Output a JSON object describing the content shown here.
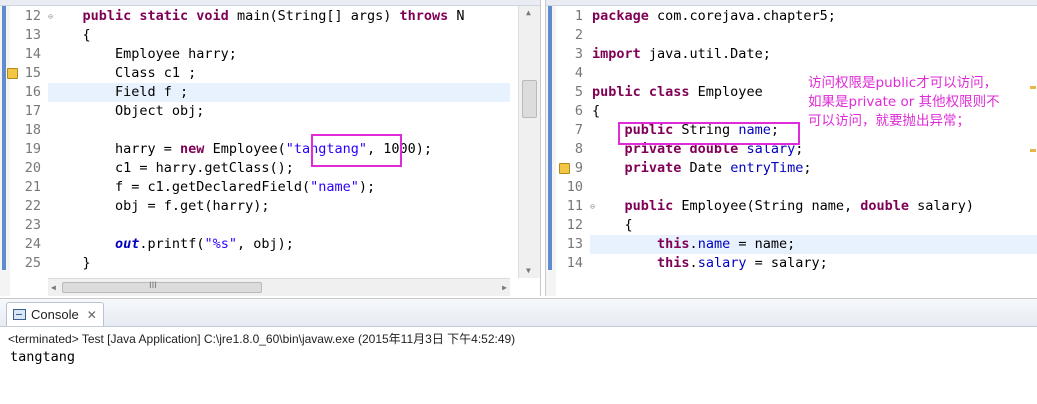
{
  "left_editor": {
    "lines": [
      {
        "n": "12",
        "hl": false,
        "warn": false,
        "fold": true,
        "tokens": [
          [
            "",
            "    "
          ],
          [
            "kw",
            "public static void "
          ],
          [
            "",
            "main(String[] args) "
          ],
          [
            "kw",
            "throws"
          ],
          [
            "",
            " N"
          ]
        ]
      },
      {
        "n": "13",
        "hl": false,
        "warn": false,
        "fold": false,
        "tokens": [
          [
            "",
            "    {"
          ]
        ]
      },
      {
        "n": "14",
        "hl": false,
        "warn": false,
        "fold": false,
        "tokens": [
          [
            "",
            "        Employee harry;"
          ]
        ]
      },
      {
        "n": "15",
        "hl": false,
        "warn": true,
        "fold": false,
        "tokens": [
          [
            "",
            "        Class c1 ;"
          ]
        ]
      },
      {
        "n": "16",
        "hl": true,
        "warn": false,
        "fold": false,
        "tokens": [
          [
            "",
            "        Field f ;"
          ]
        ]
      },
      {
        "n": "17",
        "hl": false,
        "warn": false,
        "fold": false,
        "tokens": [
          [
            "",
            "        Object obj;"
          ]
        ]
      },
      {
        "n": "18",
        "hl": false,
        "warn": false,
        "fold": false,
        "tokens": [
          [
            "",
            ""
          ]
        ]
      },
      {
        "n": "19",
        "hl": false,
        "warn": false,
        "fold": false,
        "tokens": [
          [
            "",
            "        harry = "
          ],
          [
            "kw",
            "new "
          ],
          [
            "",
            "Employee("
          ],
          [
            "str",
            "\"tangtang\""
          ],
          [
            "",
            ", 1000);"
          ]
        ]
      },
      {
        "n": "20",
        "hl": false,
        "warn": false,
        "fold": false,
        "tokens": [
          [
            "",
            "        c1 = harry.getClass();"
          ]
        ]
      },
      {
        "n": "21",
        "hl": false,
        "warn": false,
        "fold": false,
        "tokens": [
          [
            "",
            "        f = c1.getDeclaredField("
          ],
          [
            "str",
            "\"name\""
          ],
          [
            "",
            ");"
          ]
        ]
      },
      {
        "n": "22",
        "hl": false,
        "warn": false,
        "fold": false,
        "tokens": [
          [
            "",
            "        obj = f.get(harry);"
          ]
        ]
      },
      {
        "n": "23",
        "hl": false,
        "warn": false,
        "fold": false,
        "tokens": [
          [
            "",
            ""
          ]
        ]
      },
      {
        "n": "24",
        "hl": false,
        "warn": false,
        "fold": false,
        "tokens": [
          [
            "",
            "        "
          ],
          [
            "sfld",
            "out"
          ],
          [
            "",
            ".printf("
          ],
          [
            "str",
            "\"%s\""
          ],
          [
            "",
            ", obj);"
          ]
        ]
      },
      {
        "n": "25",
        "hl": false,
        "warn": false,
        "fold": false,
        "tokens": [
          [
            "",
            "    }"
          ]
        ]
      }
    ],
    "hscroll_thumb_label": "III"
  },
  "right_editor": {
    "lines": [
      {
        "n": "1",
        "hl": false,
        "warn": false,
        "fold": false,
        "tokens": [
          [
            "kw",
            "package "
          ],
          [
            "",
            "com.corejava.chapter5;"
          ]
        ]
      },
      {
        "n": "2",
        "hl": false,
        "warn": false,
        "fold": false,
        "tokens": [
          [
            "",
            ""
          ]
        ]
      },
      {
        "n": "3",
        "hl": false,
        "warn": false,
        "fold": false,
        "tokens": [
          [
            "kw",
            "import "
          ],
          [
            "",
            "java.util.Date;"
          ]
        ]
      },
      {
        "n": "4",
        "hl": false,
        "warn": false,
        "fold": false,
        "tokens": [
          [
            "",
            ""
          ]
        ]
      },
      {
        "n": "5",
        "hl": false,
        "warn": false,
        "fold": false,
        "tokens": [
          [
            "kw",
            "public class "
          ],
          [
            "",
            "Employee"
          ]
        ]
      },
      {
        "n": "6",
        "hl": false,
        "warn": false,
        "fold": false,
        "tokens": [
          [
            "",
            "{"
          ]
        ]
      },
      {
        "n": "7",
        "hl": false,
        "warn": false,
        "fold": false,
        "tokens": [
          [
            "",
            "    "
          ],
          [
            "kw",
            "public "
          ],
          [
            "",
            "String "
          ],
          [
            "fld",
            "name"
          ],
          [
            "",
            ";"
          ]
        ]
      },
      {
        "n": "8",
        "hl": false,
        "warn": false,
        "fold": false,
        "tokens": [
          [
            "",
            "    "
          ],
          [
            "kw",
            "private double "
          ],
          [
            "fld",
            "salary"
          ],
          [
            "",
            ";"
          ]
        ]
      },
      {
        "n": "9",
        "hl": false,
        "warn": true,
        "fold": false,
        "tokens": [
          [
            "",
            "    "
          ],
          [
            "kw",
            "private "
          ],
          [
            "",
            "Date "
          ],
          [
            "fld",
            "entryTime"
          ],
          [
            "",
            ";"
          ]
        ]
      },
      {
        "n": "10",
        "hl": false,
        "warn": false,
        "fold": false,
        "tokens": [
          [
            "",
            ""
          ]
        ]
      },
      {
        "n": "11",
        "hl": false,
        "warn": false,
        "fold": true,
        "tokens": [
          [
            "",
            "    "
          ],
          [
            "kw",
            "public "
          ],
          [
            "",
            "Employee(String name, "
          ],
          [
            "kw",
            "double "
          ],
          [
            "",
            "salary)"
          ]
        ]
      },
      {
        "n": "12",
        "hl": false,
        "warn": false,
        "fold": false,
        "tokens": [
          [
            "",
            "    {"
          ]
        ]
      },
      {
        "n": "13",
        "hl": true,
        "warn": false,
        "fold": false,
        "tokens": [
          [
            "",
            "        "
          ],
          [
            "kw",
            "this"
          ],
          [
            "",
            "."
          ],
          [
            "fld",
            "name"
          ],
          [
            "",
            " = name;"
          ]
        ]
      },
      {
        "n": "14",
        "hl": false,
        "warn": false,
        "fold": false,
        "tokens": [
          [
            "",
            "        "
          ],
          [
            "kw",
            "this"
          ],
          [
            "",
            "."
          ],
          [
            "fld",
            "salary"
          ],
          [
            "",
            " = salary;"
          ]
        ]
      }
    ]
  },
  "annotation": {
    "lines": [
      "访问权限是public才可以访问，",
      "如果是private or 其他权限则不",
      "可以访问，就要抛出异常；"
    ]
  },
  "console": {
    "tab_label": "Console",
    "close_symbol": "✕",
    "status": "<terminated> Test [Java Application] C:\\jre1.8.0_60\\bin\\javaw.exe (2015年11月3日 下午4:52:49)",
    "output": "tangtang"
  },
  "colors": {
    "keyword": "#7f0055",
    "string": "#2a00ff",
    "field": "#0000c0",
    "annotation": "#e02bd8",
    "current_line": "#e8f2fe"
  }
}
